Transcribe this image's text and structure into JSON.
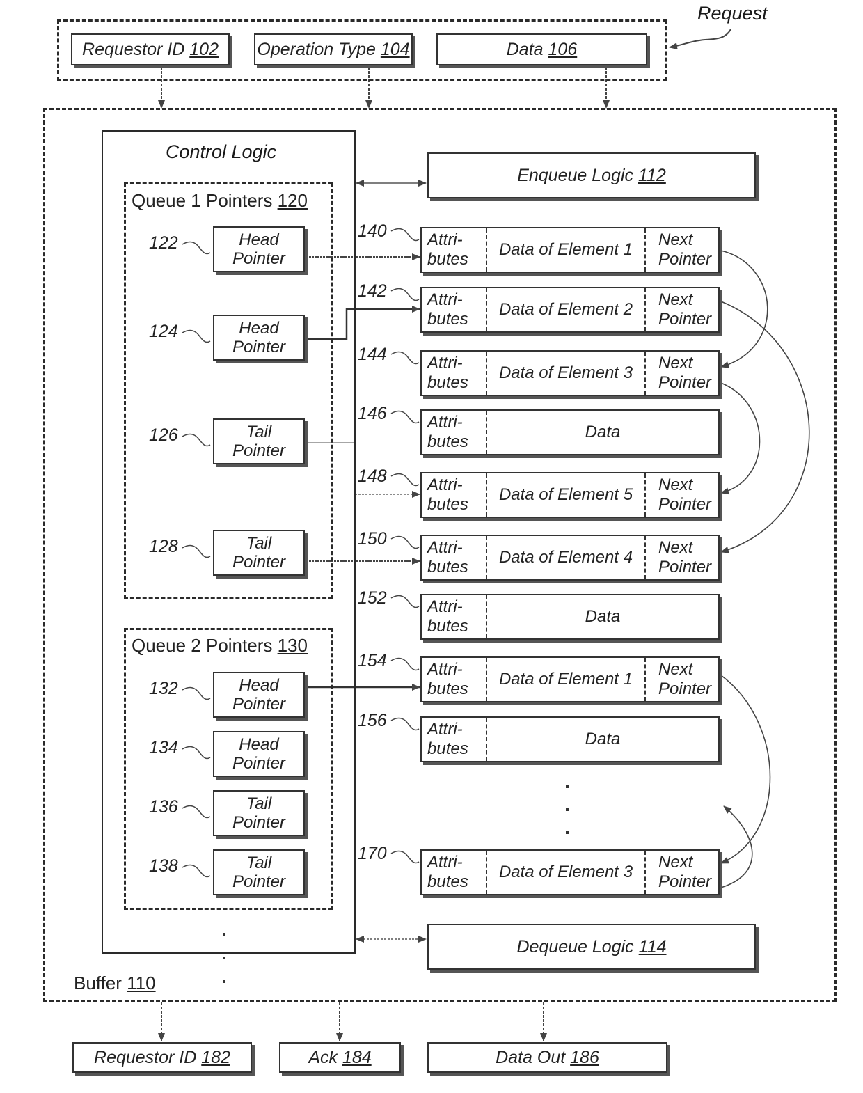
{
  "request": {
    "label": "Request",
    "fields": [
      {
        "name": "Requestor ID",
        "ref": "102"
      },
      {
        "name": "Operation Type",
        "ref": "104"
      },
      {
        "name": "Data",
        "ref": "106"
      }
    ]
  },
  "buffer": {
    "name": "Buffer",
    "ref": "110"
  },
  "control_logic": {
    "title": "Control Logic"
  },
  "enqueue": {
    "name": "Enqueue Logic",
    "ref": "112"
  },
  "dequeue": {
    "name": "Dequeue Logic",
    "ref": "114"
  },
  "queue1": {
    "title": "Queue 1 Pointers",
    "ref": "120",
    "pointers": [
      {
        "ref": "122",
        "line1": "Head",
        "line2": "Pointer"
      },
      {
        "ref": "124",
        "line1": "Head",
        "line2": "Pointer"
      },
      {
        "ref": "126",
        "line1": "Tail",
        "line2": "Pointer"
      },
      {
        "ref": "128",
        "line1": "Tail",
        "line2": "Pointer"
      }
    ]
  },
  "queue2": {
    "title": "Queue 2 Pointers",
    "ref": "130",
    "pointers": [
      {
        "ref": "132",
        "line1": "Head",
        "line2": "Pointer"
      },
      {
        "ref": "134",
        "line1": "Head",
        "line2": "Pointer"
      },
      {
        "ref": "136",
        "line1": "Tail",
        "line2": "Pointer"
      },
      {
        "ref": "138",
        "line1": "Tail",
        "line2": "Pointer"
      }
    ]
  },
  "entries": [
    {
      "ref": "140",
      "attr1": "Attri-",
      "attr2": "butes",
      "data": "Data of Element 1",
      "next1": "Next",
      "next2": "Pointer"
    },
    {
      "ref": "142",
      "attr1": "Attri-",
      "attr2": "butes",
      "data": "Data of Element 2",
      "next1": "Next",
      "next2": "Pointer"
    },
    {
      "ref": "144",
      "attr1": "Attri-",
      "attr2": "butes",
      "data": "Data of Element 3",
      "next1": "Next",
      "next2": "Pointer"
    },
    {
      "ref": "146",
      "attr1": "Attri-",
      "attr2": "butes",
      "data": "Data",
      "next1": "",
      "next2": ""
    },
    {
      "ref": "148",
      "attr1": "Attri-",
      "attr2": "butes",
      "data": "Data of Element 5",
      "next1": "Next",
      "next2": "Pointer"
    },
    {
      "ref": "150",
      "attr1": "Attri-",
      "attr2": "butes",
      "data": "Data of Element 4",
      "next1": "Next",
      "next2": "Pointer"
    },
    {
      "ref": "152",
      "attr1": "Attri-",
      "attr2": "butes",
      "data": "Data",
      "next1": "",
      "next2": ""
    },
    {
      "ref": "154",
      "attr1": "Attri-",
      "attr2": "butes",
      "data": "Data of Element 1",
      "next1": "Next",
      "next2": "Pointer"
    },
    {
      "ref": "156",
      "attr1": "Attri-",
      "attr2": "butes",
      "data": "Data",
      "next1": "",
      "next2": ""
    },
    {
      "ref": "170",
      "attr1": "Attri-",
      "attr2": "butes",
      "data": "Data of Element 3",
      "next1": "Next",
      "next2": "Pointer"
    }
  ],
  "outputs": [
    {
      "name": "Requestor ID",
      "ref": "182"
    },
    {
      "name": "Ack",
      "ref": "184"
    },
    {
      "name": "Data Out",
      "ref": "186"
    }
  ]
}
